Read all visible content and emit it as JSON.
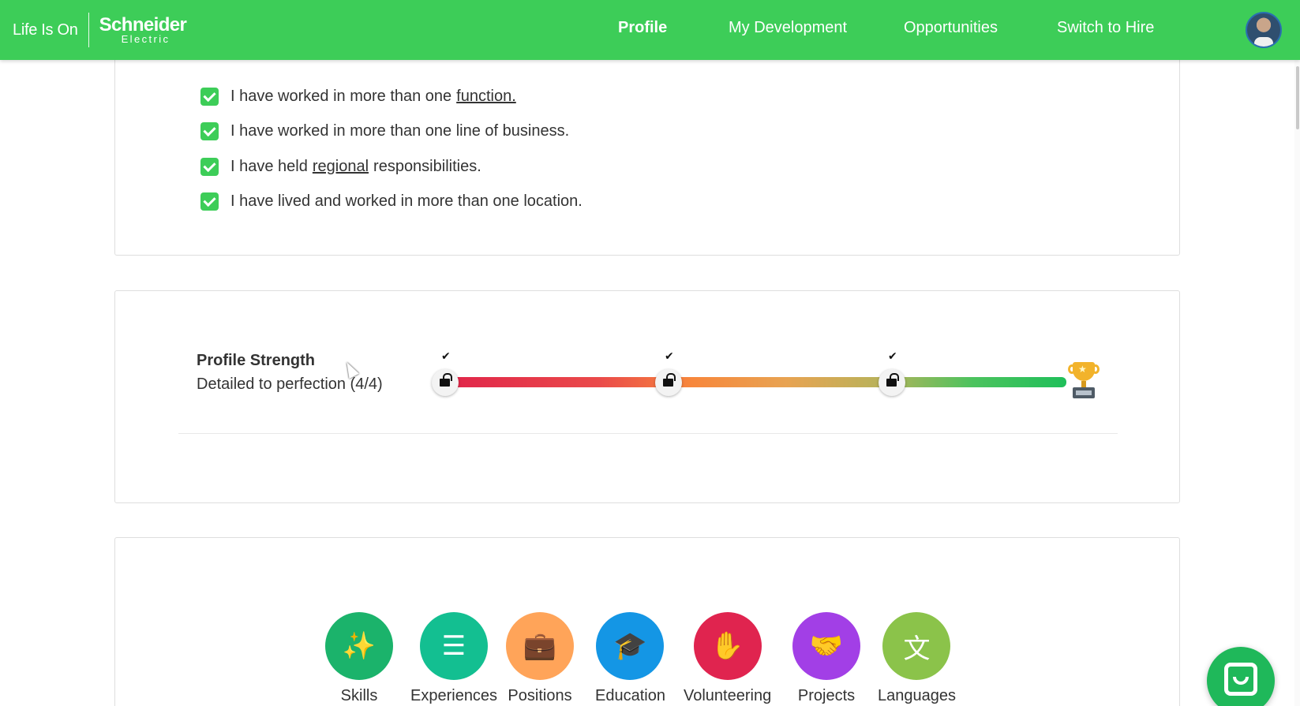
{
  "header": {
    "tagline": "Life Is On",
    "brand_top": "Schneider",
    "brand_bottom": "Electric",
    "nav": [
      {
        "label": "Profile",
        "active": true
      },
      {
        "label": "My Development",
        "active": false
      },
      {
        "label": "Opportunities",
        "active": false
      },
      {
        "label": "Switch to Hire",
        "active": false
      }
    ],
    "brand_color": "#3dcd58"
  },
  "checklist": {
    "items": [
      {
        "pre": "I have worked in more than one",
        "link": "function.",
        "post": ""
      },
      {
        "pre": "I have worked in more than one line of business.",
        "link": "",
        "post": ""
      },
      {
        "pre": "I have held",
        "link": "regional",
        "post": "responsibilities."
      },
      {
        "pre": "I have lived and worked in more than one location.",
        "link": "",
        "post": ""
      }
    ]
  },
  "profile_strength": {
    "title": "Profile Strength",
    "subtitle": "Detailed to perfection (4/4)",
    "completed": 4,
    "total": 4,
    "milestones_checked": [
      true,
      true,
      true
    ]
  },
  "sections": [
    {
      "label": "Skills",
      "icon": "magic-wand-icon",
      "color": "#1bb36b",
      "glyph": "✨"
    },
    {
      "label": "Experiences",
      "icon": "list-icon",
      "color": "#13bf91",
      "glyph": "☰"
    },
    {
      "label": "Positions",
      "icon": "briefcase-icon",
      "color": "#ffa459",
      "glyph": "💼"
    },
    {
      "label": "Education",
      "icon": "graduation-cap-icon",
      "color": "#1496e5",
      "glyph": "🎓"
    },
    {
      "label": "Volunteering",
      "icon": "hand-heart-icon",
      "color": "#e0244f",
      "glyph": "✋"
    },
    {
      "label": "Projects",
      "icon": "handshake-icon",
      "color": "#a23fe6",
      "glyph": "🤝"
    },
    {
      "label": "Languages",
      "icon": "translate-icon",
      "color": "#8bc34a",
      "glyph": "文"
    }
  ]
}
